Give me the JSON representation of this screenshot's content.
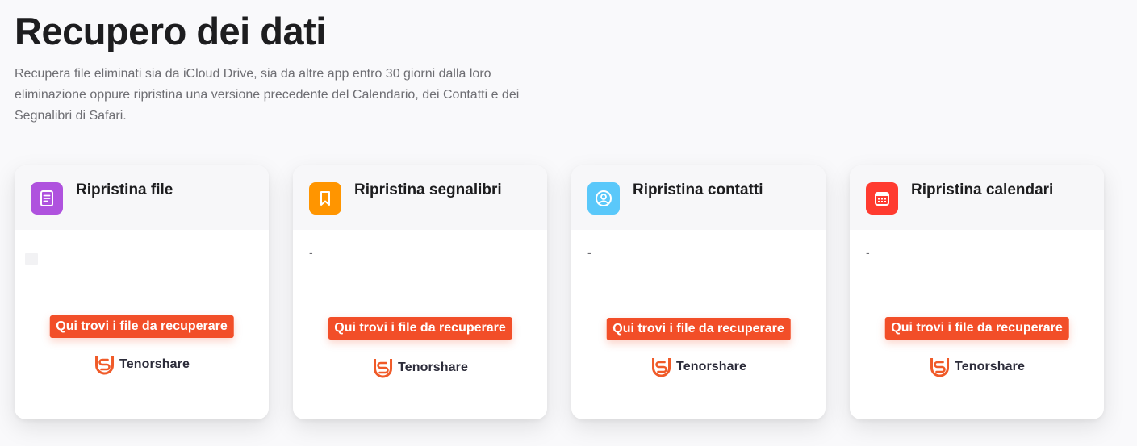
{
  "page": {
    "title": "Recupero dei dati",
    "description": "Recupera file eliminati sia da iCloud Drive, sia da altre app entro 30 giorni dalla loro eliminazione oppure ripristina una versione precedente del Calendario, dei Contatti e dei Segnalibri di Safari."
  },
  "cards": [
    {
      "title": "Ripristina file",
      "icon": "document-icon",
      "icon_color": "#af52de",
      "body": "",
      "ad_label": "Qui trovi i file da recuperare",
      "brand": "Tenorshare"
    },
    {
      "title": "Ripristina segnalibri",
      "icon": "bookmark-icon",
      "icon_color": "#ff9500",
      "body": "-",
      "ad_label": "Qui trovi i file da recuperare",
      "brand": "Tenorshare"
    },
    {
      "title": "Ripristina contatti",
      "icon": "contact-icon",
      "icon_color": "#5ac8fa",
      "body": "-",
      "ad_label": "Qui trovi i file da recuperare",
      "brand": "Tenorshare"
    },
    {
      "title": "Ripristina calendari",
      "icon": "calendar-icon",
      "icon_color": "#ff3b30",
      "body": "-",
      "ad_label": "Qui trovi i file da recuperare",
      "brand": "Tenorshare"
    }
  ],
  "colors": {
    "accent": "#f24e28",
    "brand_logo": "#f05a28"
  }
}
